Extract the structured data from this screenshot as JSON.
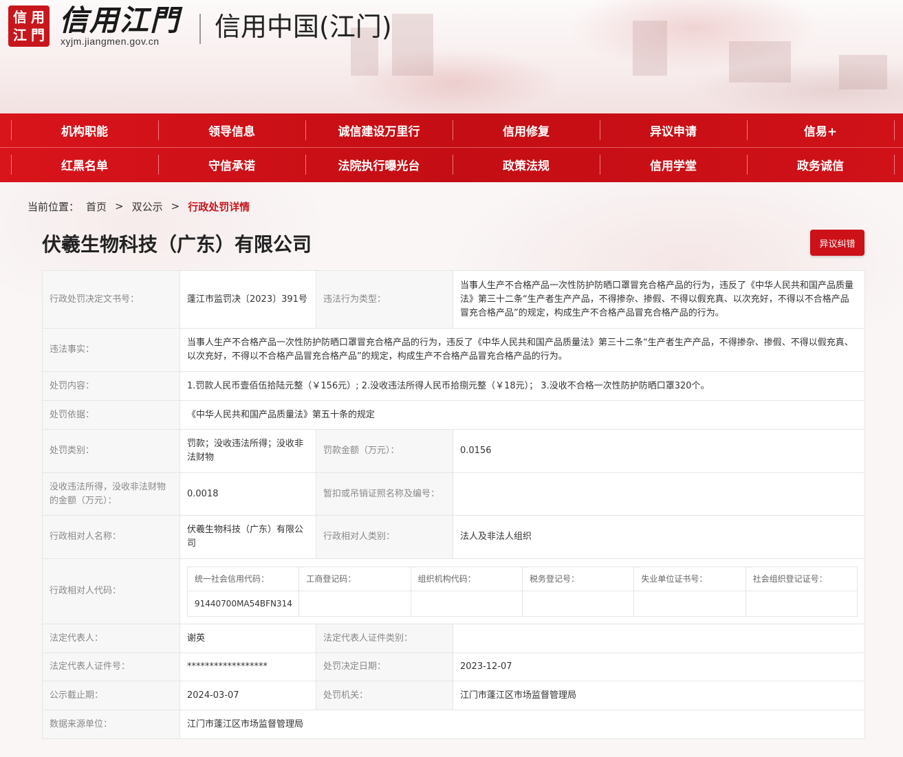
{
  "header": {
    "logo_seal_chars": [
      "信",
      "用",
      "江",
      "門"
    ],
    "logo_text": "信用江門",
    "logo_url": "xyjm.jiangmen.gov.cn",
    "site_title": "信用中国(江门)"
  },
  "nav": {
    "row1": [
      "机构职能",
      "领导信息",
      "诚信建设万里行",
      "信用修复",
      "异议申请",
      "信易+"
    ],
    "row2": [
      "红黑名单",
      "守信承诺",
      "法院执行曝光台",
      "政策法规",
      "信用学堂",
      "政务诚信"
    ]
  },
  "breadcrumb": {
    "prefix": "当前位置：",
    "items": [
      "首页",
      "双公示"
    ],
    "separator": ">",
    "current": "行政处罚详情"
  },
  "page": {
    "title": "伏羲生物科技（广东）有限公司",
    "objection_button": "异议纠错"
  },
  "detail": {
    "decision_no_label": "行政处罚决定文书号：",
    "decision_no": "蓬江市监罚决〔2023〕391号",
    "violation_type_label": "违法行为类型：",
    "violation_type": "当事人生产不合格产品一次性防护防晒口罩冒充合格产品的行为，违反了《中华人民共和国产品质量法》第三十二条“生产者生产产品，不得掺杂、掺假、不得以假充真、以次充好，不得以不合格产品冒充合格产品”的规定，构成生产不合格产品冒充合格产品的行为。",
    "facts_label": "违法事实：",
    "facts": "当事人生产不合格产品一次性防护防晒口罩冒充合格产品的行为，违反了《中华人民共和国产品质量法》第三十二条“生产者生产产品，不得掺杂、掺假、不得以假充真、以次充好，不得以不合格产品冒充合格产品”的规定，构成生产不合格产品冒充合格产品的行为。",
    "content_label": "处罚内容：",
    "content": "1.罚款人民币壹佰伍拾陆元整（￥156元）; 2.没收违法所得人民币拾捌元整（￥18元）； 3.没收不合格一次性防护防晒口罩320个。",
    "basis_label": "处罚依据：",
    "basis": "《中华人民共和国产品质量法》第五十条的规定",
    "category_label": "处罚类别：",
    "category": "罚款；没收违法所得；没收非法财物",
    "fine_label": "罚款金额（万元）：",
    "fine": "0.0156",
    "confiscated_label": "没收违法所得，没收非法财物的金额（万元）：",
    "confiscated": "0.0018",
    "license_label": "暂扣或吊销证照名称及编号：",
    "license": "",
    "party_name_label": "行政相对人名称：",
    "party_name": "伏羲生物科技（广东）有限公司",
    "party_type_label": "行政相对人类别：",
    "party_type": "法人及非法人组织",
    "party_code_label": "行政相对人代码：",
    "codes_headers": [
      "统一社会信用代码：",
      "工商登记码：",
      "组织机构代码：",
      "税务登记号：",
      "失业单位证书号：",
      "社会组织登记证号："
    ],
    "codes_values": [
      "91440700MA54BFN314",
      "",
      "",
      "",
      "",
      ""
    ],
    "legal_rep_label": "法定代表人：",
    "legal_rep": "谢英",
    "legal_rep_id_type_label": "法定代表人证件类别：",
    "legal_rep_id_type": "",
    "legal_rep_id_label": "法定代表人证件号：",
    "legal_rep_id": "******************",
    "decision_date_label": "处罚决定日期：",
    "decision_date": "2023-12-07",
    "publicity_end_label": "公示截止期：",
    "publicity_end": "2024-03-07",
    "authority_label": "处罚机关：",
    "authority": "江门市蓬江区市场监督管理局",
    "source_label": "数据来源单位：",
    "source": "江门市蓬江区市场监督管理局"
  },
  "colors": {
    "brand_red": "#c8161d",
    "nav_red": "#d9141b"
  }
}
